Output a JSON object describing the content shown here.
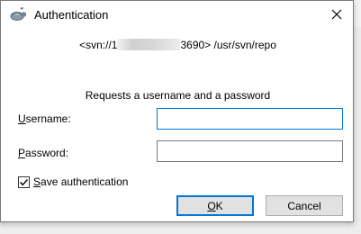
{
  "window": {
    "title": "Authentication",
    "close_glyph": "✕"
  },
  "server": {
    "prefix": "<svn://1",
    "suffix": "3690> /usr/svn/repo"
  },
  "prompt": "Requests a username and a password",
  "username": {
    "label_mnemonic": "U",
    "label_rest": "sername:",
    "value": ""
  },
  "password": {
    "label_mnemonic": "P",
    "label_rest": "assword:",
    "value": ""
  },
  "save_auth": {
    "checked": true,
    "label_mnemonic": "S",
    "label_rest": "ave authentication"
  },
  "buttons": {
    "ok_mnemonic": "O",
    "ok_rest": "K",
    "cancel": "Cancel"
  },
  "colors": {
    "focus_border": "#0078d7",
    "button_face": "#e1e1e1"
  },
  "icons": {
    "title": "tortoisesvn-icon",
    "close": "close-icon",
    "check": "checkmark-icon"
  }
}
